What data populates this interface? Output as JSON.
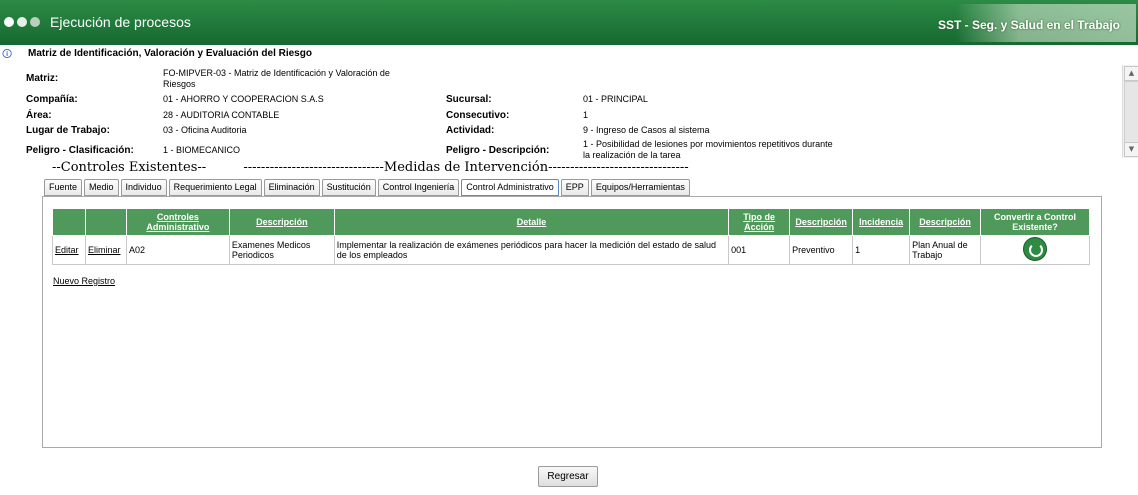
{
  "header": {
    "title": "Ejecución de procesos",
    "brand": "SST - Seg. y Salud en el Trabajo"
  },
  "page_title": "Matriz de Identificación, Valoración y Evaluación del Riesgo",
  "fields": {
    "matriz": {
      "label": "Matriz:",
      "value": "FO-MIPVER-03 - Matriz de Identificación y Valoración de Riesgos"
    },
    "compania": {
      "label": "Compañía:",
      "value": "01 - AHORRO Y COOPERACION S.A.S"
    },
    "sucursal": {
      "label": "Sucursal:",
      "value": "01 - PRINCIPAL"
    },
    "area": {
      "label": "Área:",
      "value": "28 - AUDITORIA CONTABLE"
    },
    "consecutivo": {
      "label": "Consecutivo:",
      "value": "1"
    },
    "lugar": {
      "label": "Lugar de Trabajo:",
      "value": "03 - Oficina Auditoria"
    },
    "actividad": {
      "label": "Actividad:",
      "value": "9 - Ingreso de Casos al sistema"
    },
    "peligro_clasificacion": {
      "label": "Peligro - Clasificación:",
      "value": "1 - BIOMECANICO"
    },
    "peligro_descripcion": {
      "label": "Peligro - Descripción:",
      "value": "1 - Posibilidad de lesiones por movimientos repetitivos durante la realización de la tarea"
    }
  },
  "section_line": "--Controles Existentes--         --------------------------------Medidas de Intervención--------------------------------",
  "tabs": [
    "Fuente",
    "Medio",
    "Individuo",
    "Requerimiento Legal",
    "Eliminación",
    "Sustitución",
    "Control Ingeniería",
    "Control Administrativo",
    "EPP",
    "Equipos/Herramientas"
  ],
  "active_tab": "Control Administrativo",
  "table": {
    "headers": [
      "",
      "",
      "Controles Administrativo",
      "Descripción",
      "Detalle",
      "Tipo de Acción",
      "Descripción",
      "Incidencia",
      "Descripción",
      "Convertir a Control Existente?"
    ],
    "rows": [
      {
        "edit": "Editar",
        "delete": "Eliminar",
        "code": "A02",
        "descripcion": "Examenes Medicos Periodicos",
        "detalle": "Implementar la realización de exámenes periódicos para hacer la medición del estado de salud de los empleados",
        "tipo_accion": "001",
        "tipo_descripcion": "Preventivo",
        "incidencia": "1",
        "incidencia_descripcion": "Plan Anual de Trabajo"
      }
    ]
  },
  "nuevo_registro": "Nuevo Registro",
  "regresar": "Regresar",
  "icons": {
    "info": "info-icon",
    "convert": "refresh-icon"
  },
  "colors": {
    "header": "#1e7a3a",
    "table_header": "#4f9a5b"
  }
}
